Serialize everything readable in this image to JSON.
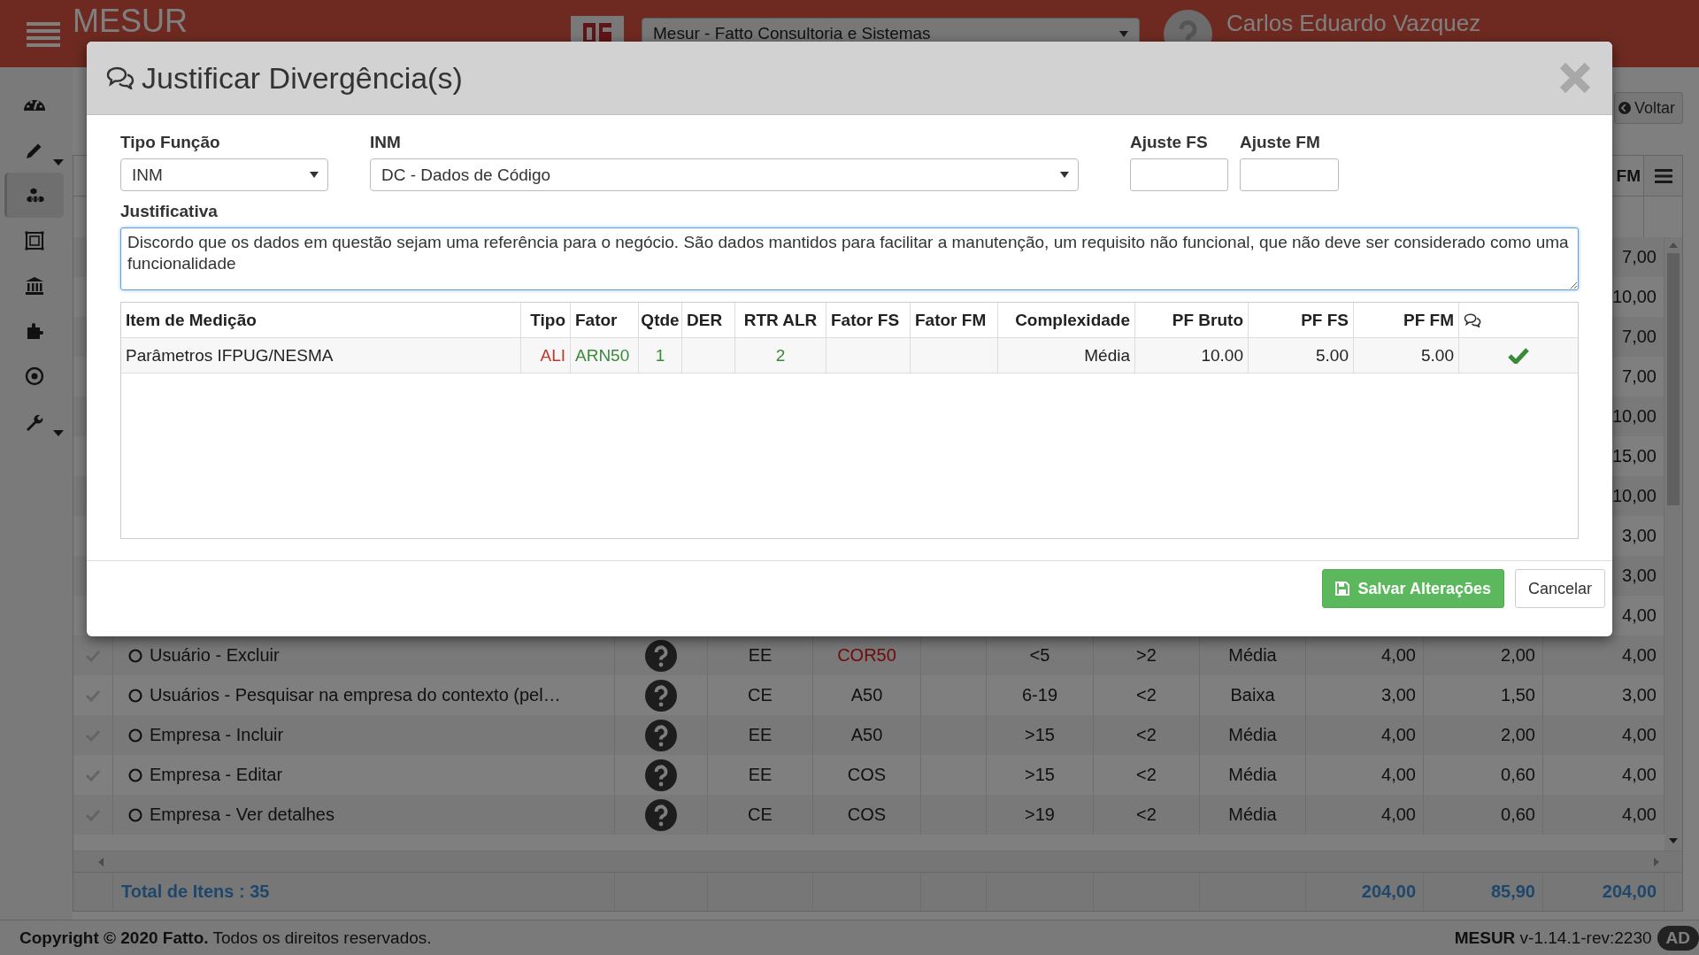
{
  "header": {
    "app_name": "MESUR",
    "company": "Mesur - Fatto Consultoria e Sistemas",
    "user_name": "Carlos Eduardo Vazquez"
  },
  "sidebar": {
    "items": [
      {
        "kind": "gauge",
        "selected": false,
        "submenu": false
      },
      {
        "kind": "pencil",
        "selected": false,
        "submenu": true
      },
      {
        "kind": "cubes",
        "selected": true,
        "submenu": false
      },
      {
        "kind": "frame",
        "selected": false,
        "submenu": false
      },
      {
        "kind": "bank",
        "selected": false,
        "submenu": false
      },
      {
        "kind": "puzzle",
        "selected": false,
        "submenu": false
      },
      {
        "kind": "target",
        "selected": false,
        "submenu": false
      },
      {
        "kind": "wrench",
        "selected": false,
        "submenu": true
      }
    ]
  },
  "toolbar": {
    "back_button": "Voltar"
  },
  "grid": {
    "header_fragment": "FM",
    "rows": [
      {
        "pf_fm": "7,00"
      },
      {
        "pf_fm": "10,00"
      },
      {
        "pf_fm": "7,00"
      },
      {
        "pf_fm": "7,00"
      },
      {
        "pf_fm": "10,00"
      },
      {
        "pf_fm": "15,00"
      },
      {
        "pf_fm": "10,00"
      },
      {
        "pf_fm": "3,00"
      },
      {
        "pf_fm": "3,00"
      },
      {
        "pf_fm": "4,00"
      },
      {
        "checked": true,
        "name": "Usuário - Excluir",
        "tipo": "EE",
        "fator": "COR50",
        "fator_alert": true,
        "der": "<5",
        "rtr": ">2",
        "complexidade": "Média",
        "pf_bruto": "4,00",
        "pf_fs": "2,00",
        "pf_fm": "4,00"
      },
      {
        "checked": true,
        "name": "Usuários - Pesquisar na empresa do contexto (pel…",
        "tipo": "CE",
        "fator": "A50",
        "fator_alert": false,
        "der": "6-19",
        "rtr": "<2",
        "complexidade": "Baixa",
        "pf_bruto": "3,00",
        "pf_fs": "1,50",
        "pf_fm": "3,00"
      },
      {
        "checked": true,
        "name": "Empresa - Incluir",
        "tipo": "EE",
        "fator": "A50",
        "fator_alert": false,
        "der": ">15",
        "rtr": "<2",
        "complexidade": "Média",
        "pf_bruto": "4,00",
        "pf_fs": "2,00",
        "pf_fm": "4,00"
      },
      {
        "checked": true,
        "name": "Empresa - Editar",
        "tipo": "EE",
        "fator": "COS",
        "fator_alert": false,
        "der": ">15",
        "rtr": "<2",
        "complexidade": "Média",
        "pf_bruto": "4,00",
        "pf_fs": "0,60",
        "pf_fm": "4,00"
      },
      {
        "checked": true,
        "name": "Empresa - Ver detalhes",
        "tipo": "CE",
        "fator": "COS",
        "fator_alert": false,
        "der": ">19",
        "rtr": "<2",
        "complexidade": "Média",
        "pf_bruto": "4,00",
        "pf_fs": "0,60",
        "pf_fm": "4,00"
      }
    ],
    "totals": {
      "label": "Total de Itens : 35",
      "pf_bruto": "204,00",
      "pf_fs": "85,90",
      "pf_fm": "204,00"
    }
  },
  "footer": {
    "copyright": "**Copyright © 2020 Fatto.** Todos os direitos reservados.",
    "version": "**MESUR** v-1.14.1-rev:2230",
    "badge": "AD"
  },
  "modal": {
    "title": "Justificar Divergência(s)",
    "fields": {
      "tipo_funcao": {
        "label": "Tipo Função",
        "value": "INM"
      },
      "inm": {
        "label": "INM",
        "value": "DC - Dados de Código"
      },
      "ajuste_fs": {
        "label": "Ajuste FS"
      },
      "ajuste_fm": {
        "label": "Ajuste FM"
      }
    },
    "justificativa": {
      "label": "Justificativa",
      "value": "Discordo que os dados em questão sejam uma referência para o negócio. São dados mantidos para facilitar a manutenção, um requisito não funcional, que não deve ser considerado como uma funcionalidade"
    },
    "table": {
      "columns": [
        "Item de Medição",
        "Tipo",
        "Fator",
        "Qtde",
        "DER",
        "RTR ALR",
        "Fator FS",
        "Fator FM",
        "Complexidade",
        "PF Bruto",
        "PF FS",
        "PF FM"
      ],
      "rows": [
        {
          "item": {
            "text": "Parâmetros IFPUG/NESMA"
          },
          "tipo": {
            "text": "ALI",
            "color": "#c0392b"
          },
          "fator": {
            "text": "ARN50",
            "color": "#3a8a3a"
          },
          "qtde": {
            "text": "1",
            "color": "#3a8a3a"
          },
          "rtr_alr": {
            "text": "2",
            "color": "#3a8a3a"
          },
          "complexidade": {
            "text": "Média"
          },
          "pf_bruto": {
            "text": "10.00"
          },
          "pf_fs": {
            "text": "5.00"
          },
          "pf_fm": {
            "text": "5.00"
          },
          "justified": true
        }
      ]
    },
    "buttons": {
      "save": "Salvar Alterações",
      "cancel": "Cancelar"
    }
  }
}
